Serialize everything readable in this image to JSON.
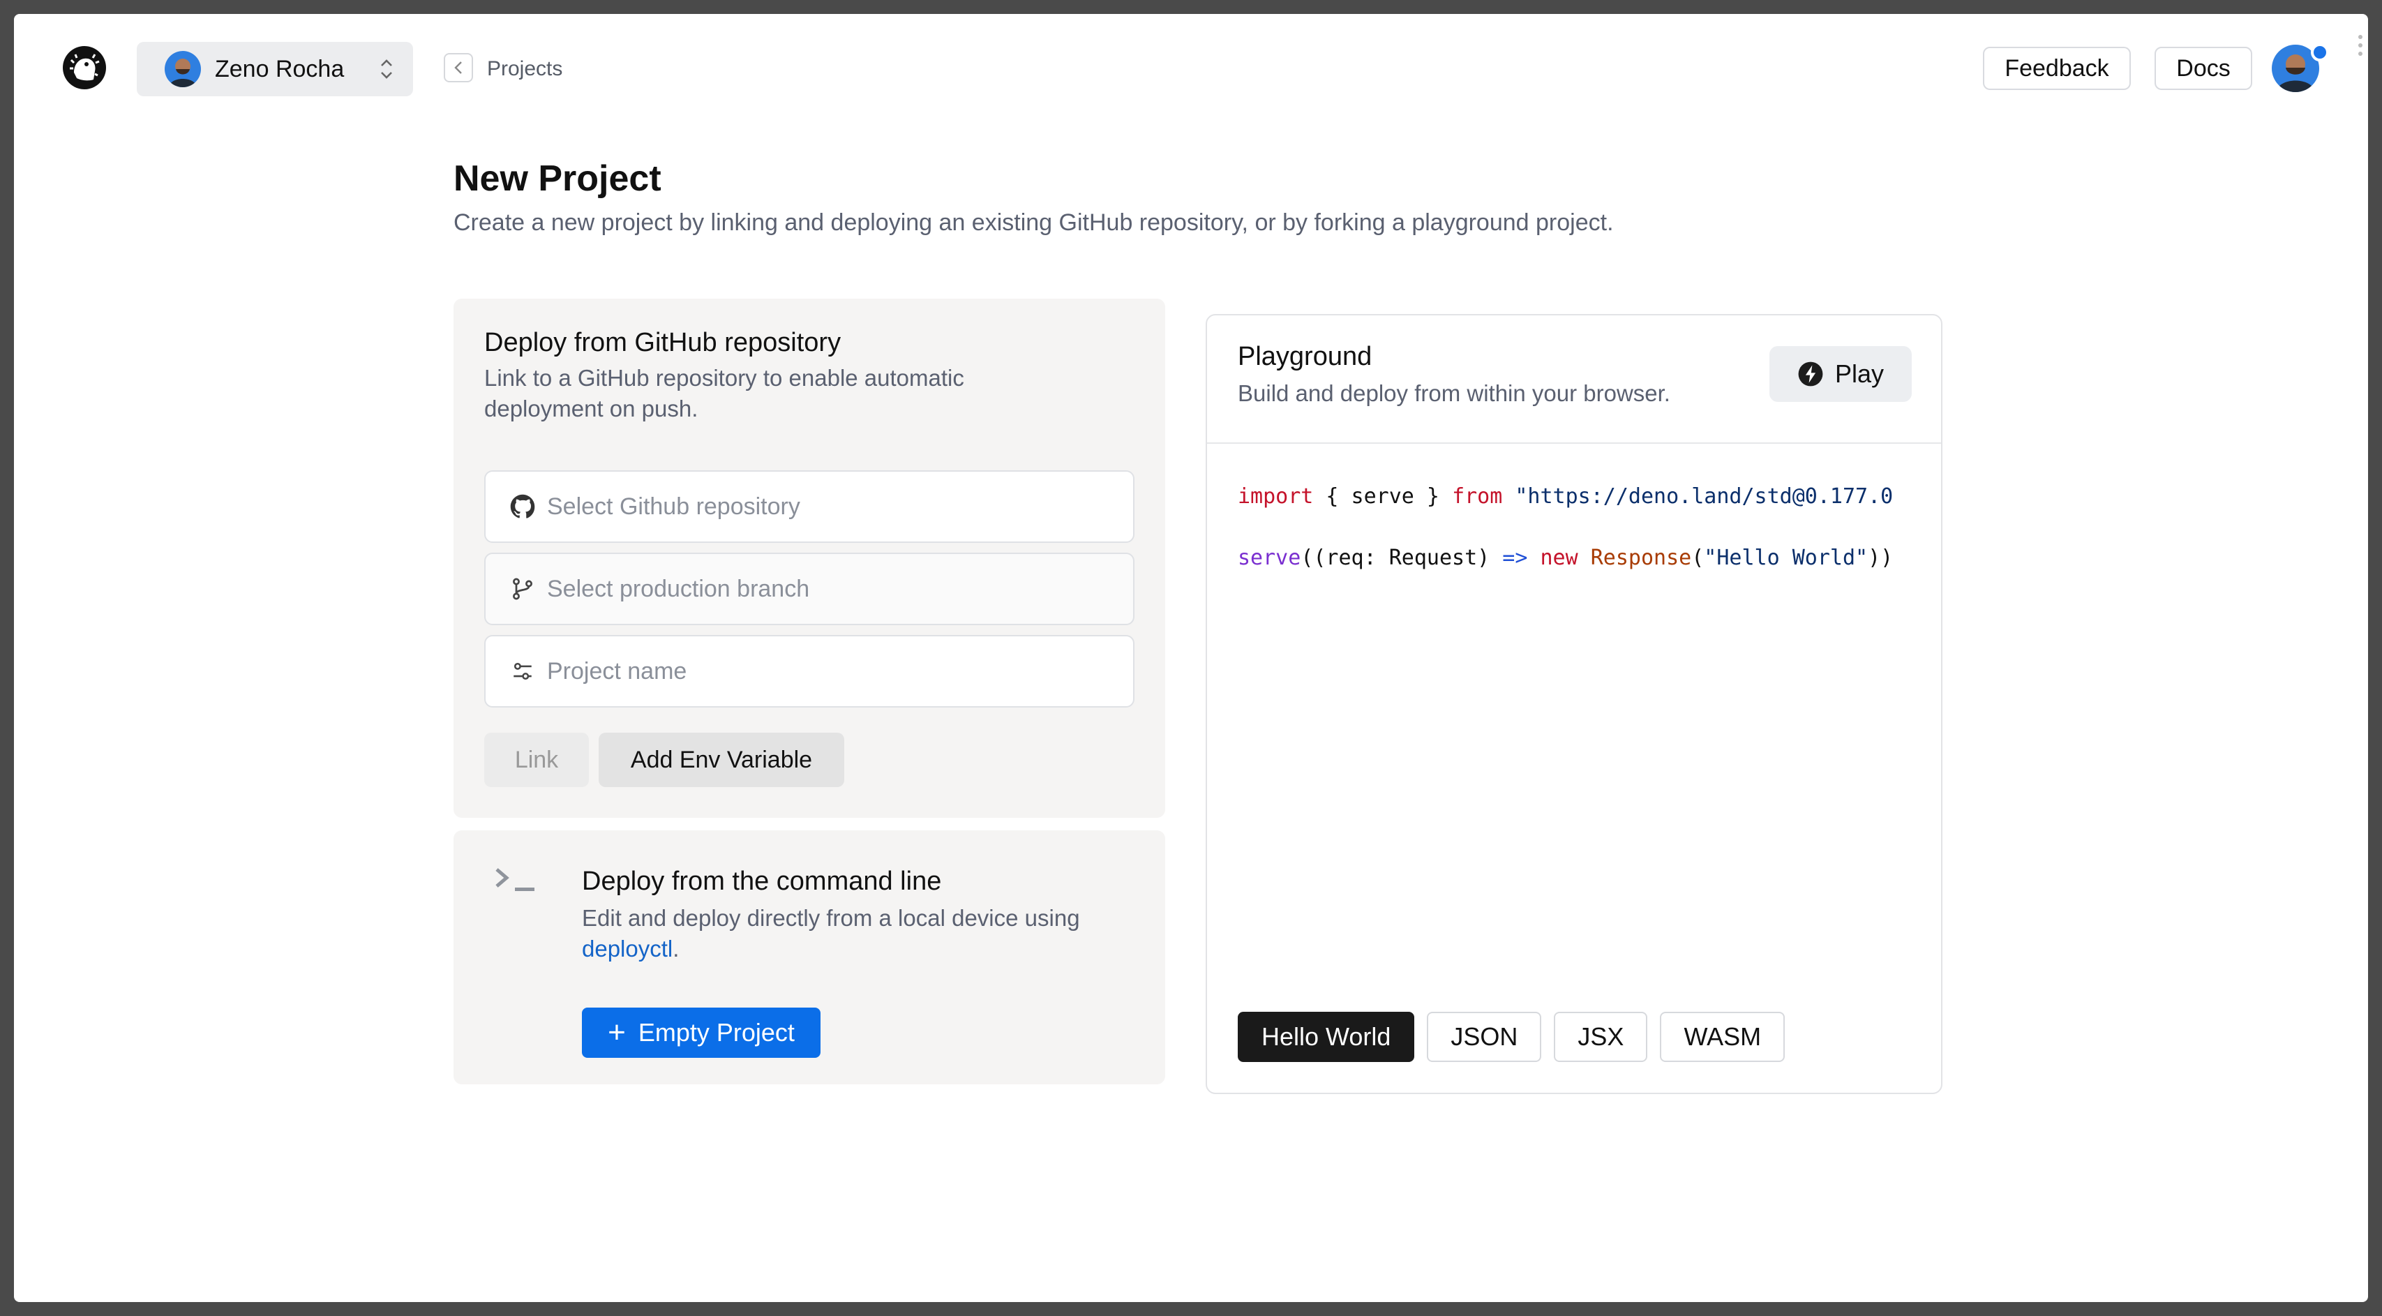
{
  "header": {
    "account_name": "Zeno Rocha",
    "breadcrumb": "Projects",
    "feedback_label": "Feedback",
    "docs_label": "Docs"
  },
  "page": {
    "title": "New Project",
    "subtitle": "Create a new project by linking and deploying an existing GitHub repository, or by forking a playground project."
  },
  "github_panel": {
    "title": "Deploy from GitHub repository",
    "description": "Link to a GitHub repository to enable automatic deployment on push.",
    "repo_placeholder": "Select Github repository",
    "branch_placeholder": "Select production branch",
    "name_placeholder": "Project name",
    "link_label": "Link",
    "env_label": "Add Env Variable"
  },
  "cli_panel": {
    "title": "Deploy from the command line",
    "description": "Edit and deploy directly from a local device using",
    "link_text": "deployctl",
    "link_suffix": ".",
    "button_label": "Empty Project"
  },
  "playground": {
    "title": "Playground",
    "description": "Build and deploy from within your browser.",
    "play_label": "Play",
    "code": {
      "line1": {
        "kw": "import",
        "mid": " { serve } ",
        "from": "from",
        "str": " \"https://deno.land/std@0.177.0"
      },
      "line2": {
        "fn": "serve",
        "a": "((req: Request) ",
        "arrow": "=>",
        "sp": " ",
        "new": "new",
        "cls": " Response",
        "b": "(",
        "str": "\"Hello World\"",
        "c": "))"
      }
    },
    "templates": [
      "Hello World",
      "JSON",
      "JSX",
      "WASM"
    ],
    "active_template": "Hello World"
  },
  "colors": {
    "primary_button": "#0b6ee8",
    "link": "#1464c8",
    "notification": "#1a73e8"
  }
}
